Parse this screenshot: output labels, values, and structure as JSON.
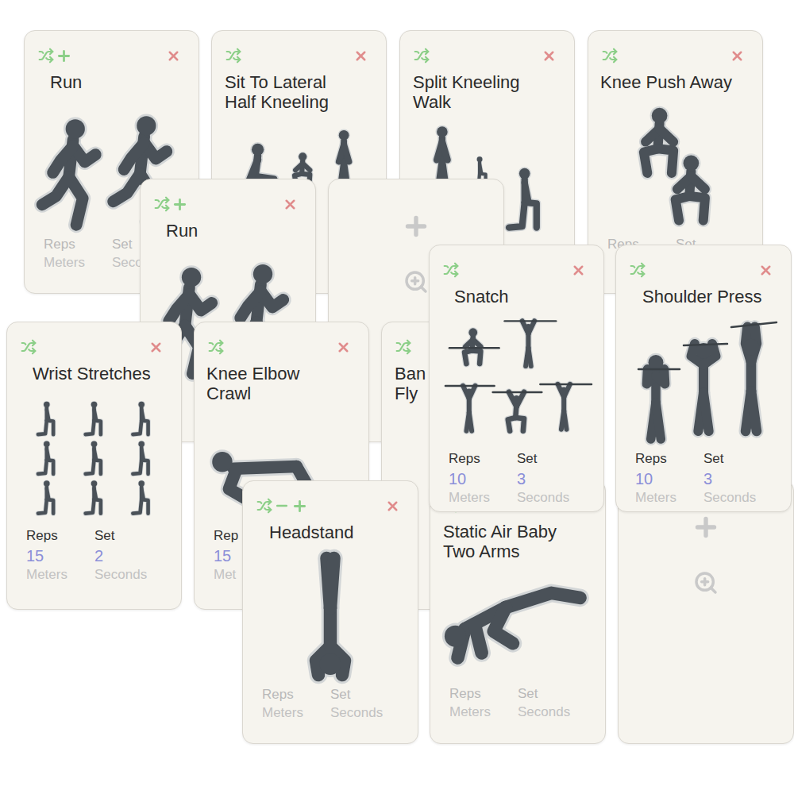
{
  "cards": [
    {
      "kind": "exercise",
      "title": [
        "Run"
      ],
      "controls": {
        "shuffle": true,
        "add": true,
        "remove": false,
        "delete": true
      },
      "stats": [
        {
          "label": "Reps",
          "unit": "Meters",
          "active": false
        },
        {
          "label": "Set",
          "unit": "Seco",
          "active": false
        }
      ]
    },
    {
      "kind": "exercise",
      "title": [
        "Sit To Lateral",
        "Half Kneeling"
      ],
      "controls": {
        "shuffle": true,
        "add": false,
        "remove": false,
        "delete": true
      },
      "stats": []
    },
    {
      "kind": "exercise",
      "title": [
        "Split Kneeling",
        "Walk"
      ],
      "controls": {
        "shuffle": true,
        "add": false,
        "remove": false,
        "delete": true
      },
      "stats": []
    },
    {
      "kind": "exercise",
      "title": [
        "Knee Push Away"
      ],
      "controls": {
        "shuffle": true,
        "add": false,
        "remove": false,
        "delete": true
      },
      "stats": [
        {
          "label": "Reps",
          "active": false
        },
        {
          "label": "Set",
          "active": false
        }
      ]
    },
    {
      "kind": "exercise",
      "title": [
        "Run"
      ],
      "controls": {
        "shuffle": true,
        "add": true,
        "remove": false,
        "delete": true
      },
      "stats": []
    },
    {
      "kind": "add"
    },
    {
      "kind": "exercise",
      "title": [
        "Wrist Stretches"
      ],
      "controls": {
        "shuffle": true,
        "add": false,
        "remove": false,
        "delete": true
      },
      "stats": [
        {
          "label": "Reps",
          "value": "15",
          "unit": "Meters",
          "active": true
        },
        {
          "label": "Set",
          "value": "2",
          "unit": "Seconds",
          "active": true
        }
      ]
    },
    {
      "kind": "exercise",
      "title": [
        "Knee Elbow",
        "Crawl"
      ],
      "controls": {
        "shuffle": true,
        "add": false,
        "remove": false,
        "delete": true
      },
      "stats": [
        {
          "label": "Rep",
          "value": "15",
          "unit": "Met",
          "active": true
        }
      ]
    },
    {
      "kind": "exercise",
      "title": [
        "Ban",
        "Fly"
      ],
      "controls": {
        "shuffle": true,
        "add": false,
        "remove": false,
        "delete": false
      },
      "stats": []
    },
    {
      "kind": "exercise",
      "title": [
        "Static Air Baby",
        "Two Arms"
      ],
      "controls": {
        "shuffle": true,
        "add": false,
        "remove": false,
        "delete": true
      },
      "stats": [
        {
          "label": "Reps",
          "unit": "Meters",
          "active": false
        },
        {
          "label": "Set",
          "unit": "Seconds",
          "active": false
        }
      ]
    },
    {
      "kind": "add"
    },
    {
      "kind": "exercise",
      "title": [
        "Snatch"
      ],
      "controls": {
        "shuffle": true,
        "add": false,
        "remove": false,
        "delete": true
      },
      "stats": [
        {
          "label": "Reps",
          "value": "10",
          "unit": "Meters",
          "active": true
        },
        {
          "label": "Set",
          "value": "3",
          "unit": "Seconds",
          "active": true
        }
      ]
    },
    {
      "kind": "exercise",
      "title": [
        "Shoulder Press"
      ],
      "controls": {
        "shuffle": true,
        "add": false,
        "remove": false,
        "delete": true
      },
      "stats": [
        {
          "label": "Reps",
          "value": "10",
          "unit": "Meters",
          "active": true
        },
        {
          "label": "Set",
          "value": "3",
          "unit": "Seconds",
          "active": true
        }
      ]
    },
    {
      "kind": "exercise",
      "title": [
        "Headstand"
      ],
      "controls": {
        "shuffle": true,
        "add": true,
        "remove": true,
        "delete": true
      },
      "stats": [
        {
          "label": "Reps",
          "unit": "Meters",
          "active": false
        },
        {
          "label": "Set",
          "unit": "Seconds",
          "active": false
        }
      ]
    }
  ]
}
